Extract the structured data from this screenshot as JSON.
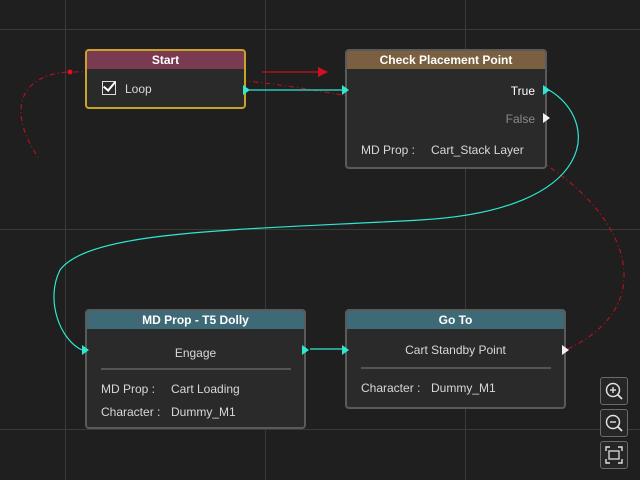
{
  "colors": {
    "start_header": "#7a3a52",
    "check_header": "#7a6040",
    "dolly_header": "#3e6a78",
    "goto_header": "#3e6a78",
    "wire_cyan": "#2ee8d0",
    "wire_red": "#c01020",
    "selected_border": "#c9a227"
  },
  "nodes": {
    "start": {
      "title": "Start",
      "loop_label": "Loop"
    },
    "check": {
      "title": "Check Placement Point",
      "true_label": "True",
      "false_label": "False",
      "prop_label": "MD Prop :",
      "prop_value": "Cart_Stack Layer"
    },
    "dolly": {
      "title": "MD Prop - T5 Dolly",
      "action": "Engage",
      "prop_label": "MD Prop :",
      "prop_value": "Cart Loading",
      "char_label": "Character :",
      "char_value": "Dummy_M1"
    },
    "goto": {
      "title": "Go To",
      "target": "Cart Standby Point",
      "char_label": "Character :",
      "char_value": "Dummy_M1"
    }
  },
  "toolbar": {
    "zoom_in_icon": "zoom-in-icon",
    "zoom_out_icon": "zoom-out-icon",
    "fit_icon": "fit-screen-icon"
  }
}
